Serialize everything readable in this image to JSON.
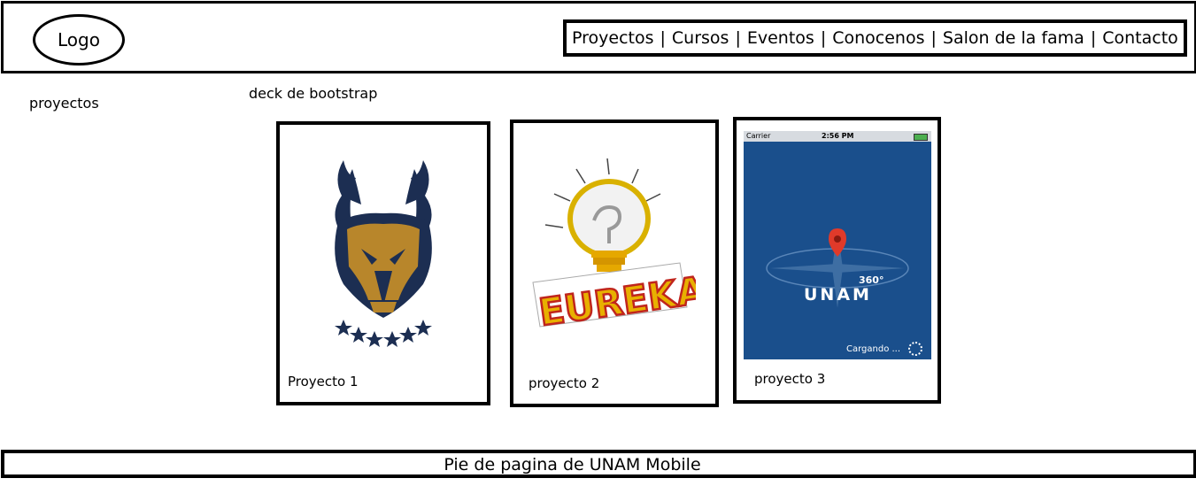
{
  "header": {
    "logo": "Logo",
    "nav": [
      {
        "label": "Proyectos"
      },
      {
        "label": "Cursos"
      },
      {
        "label": "Eventos"
      },
      {
        "label": "Conocenos"
      },
      {
        "label": "Salon de la fama"
      },
      {
        "label": "Contacto"
      }
    ],
    "separator": "|"
  },
  "sidebar": {
    "label": "proyectos"
  },
  "deck": {
    "label": "deck de bootstrap",
    "cards": [
      {
        "caption": "Proyecto 1",
        "image": "pumas-logo-icon"
      },
      {
        "caption": "proyecto 2",
        "image": "eureka-lightbulb-icon"
      },
      {
        "caption": "proyecto 3",
        "image": "unam-360-app-screenshot",
        "phone_status": {
          "carrier": "Carrier",
          "time": "2:56 PM"
        },
        "app_title": "UNAM",
        "app_badge": "360°",
        "loading_text": "Cargando ..."
      }
    ]
  },
  "footer": {
    "text": "Pie de pagina de UNAM Mobile"
  },
  "colors": {
    "border": "#000000",
    "background": "#ffffff",
    "pumas_gold": "#b8862b",
    "pumas_navy": "#1c2e52",
    "app_blue": "#1a4f8c"
  }
}
